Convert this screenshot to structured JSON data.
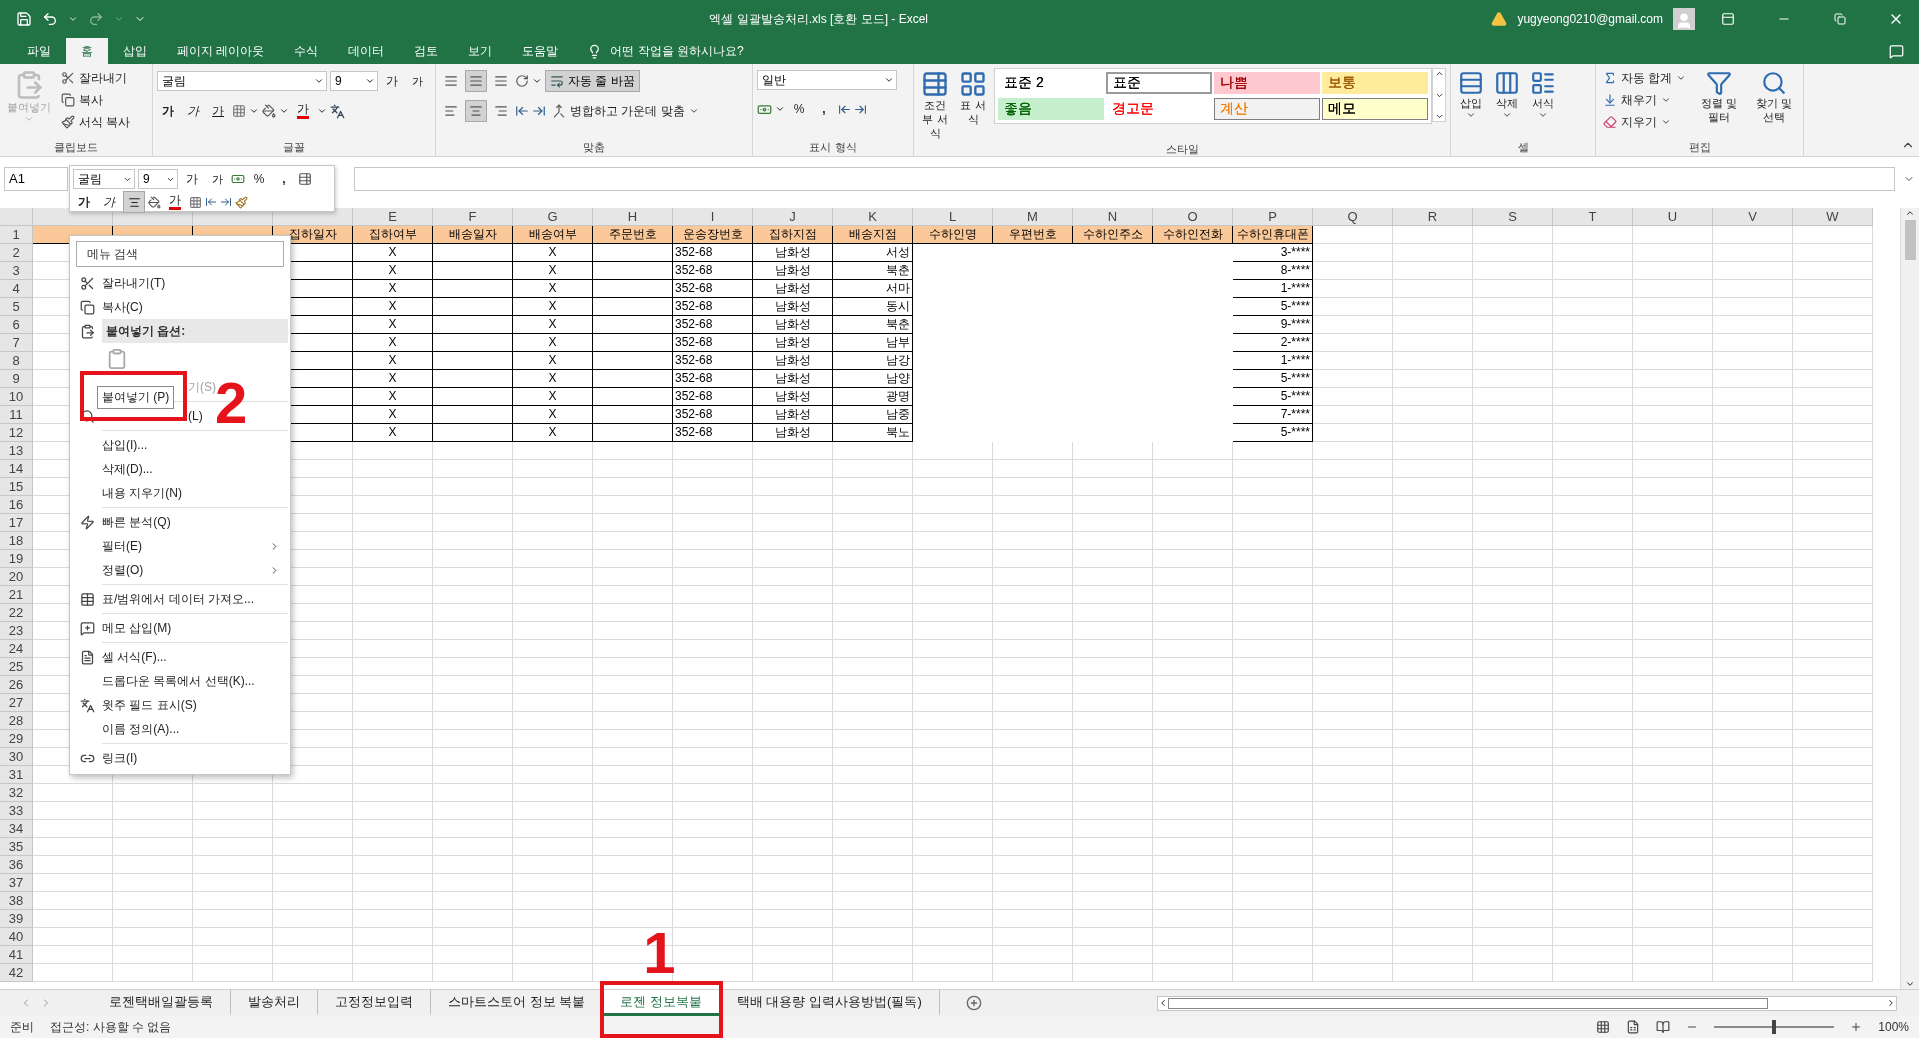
{
  "window": {
    "title": "엑셀 일괄발송처리.xls [호환 모드] - Excel",
    "account": "yugyeong0210@gmail.com"
  },
  "menu_tabs": [
    {
      "label": "파일",
      "selected": false
    },
    {
      "label": "홈",
      "selected": true
    },
    {
      "label": "삽입",
      "selected": false
    },
    {
      "label": "페이지 레이아웃",
      "selected": false
    },
    {
      "label": "수식",
      "selected": false
    },
    {
      "label": "데이터",
      "selected": false
    },
    {
      "label": "검토",
      "selected": false
    },
    {
      "label": "보기",
      "selected": false
    },
    {
      "label": "도움말",
      "selected": false
    }
  ],
  "tell_me": {
    "placeholder": "어떤 작업을 원하시나요?"
  },
  "ribbon": {
    "groups": [
      {
        "kind": "clipboard",
        "label": "클립보드",
        "paste": {
          "label": "붙여넣기",
          "disabled": true
        },
        "items": [
          "잘라내기",
          "복사",
          "서식 복사"
        ]
      },
      {
        "kind": "font",
        "label": "글꼴",
        "font": "굴림",
        "size": "9",
        "grow": "가",
        "shrink": "가",
        "bold": "가",
        "italic": "가",
        "underline": "가",
        "tint_letter": "가"
      },
      {
        "kind": "alignment",
        "label": "맞춤",
        "vertical": [
          {
            "selected": false
          },
          {
            "selected": true
          },
          {
            "selected": false
          }
        ],
        "horizontal": [
          {
            "selected": false
          },
          {
            "selected": true
          },
          {
            "selected": false
          }
        ],
        "wrap": {
          "label": "자동 줄 바꿈",
          "on": true
        },
        "merge": "병합하고 가운데 맞춤"
      },
      {
        "kind": "number",
        "label": "표시 형식",
        "format": "일반",
        "percent": "%",
        "comma": ","
      },
      {
        "kind": "styles",
        "label": "스타일",
        "buttons": [
          "조건부 서식",
          "표 서식"
        ],
        "styles": [
          {
            "label": "표준 2",
            "fill": {
              "color": "#ffffff"
            },
            "text": {
              "color": "#000000"
            },
            "selected": false,
            "outlined": false
          },
          {
            "label": "표준",
            "fill": {
              "color": "#ffffff"
            },
            "text": {
              "color": "#000000"
            },
            "selected": true,
            "outlined": false
          },
          {
            "label": "나쁨",
            "fill": {
              "color": "#ffc7ce"
            },
            "text": {
              "color": "#9c0006"
            },
            "selected": false,
            "outlined": false
          },
          {
            "label": "보통",
            "fill": {
              "color": "#ffeb9c"
            },
            "text": {
              "color": "#9c5700"
            },
            "selected": false,
            "outlined": false
          },
          {
            "label": "좋음",
            "fill": {
              "color": "#c6efce"
            },
            "text": {
              "color": "#006100"
            },
            "selected": false,
            "outlined": false
          },
          {
            "label": "경고문",
            "fill": {
              "color": "#ffffff"
            },
            "text": {
              "color": "#ff0000"
            },
            "selected": false,
            "outlined": false
          },
          {
            "label": "계산",
            "fill": {
              "color": "#f2f2f2"
            },
            "text": {
              "color": "#fa7d00"
            },
            "selected": false,
            "outlined": true
          },
          {
            "label": "메모",
            "fill": {
              "color": "#ffffcc"
            },
            "text": {
              "color": "#000000"
            },
            "selected": false,
            "outlined": true
          }
        ]
      },
      {
        "kind": "cells",
        "label": "셀",
        "buttons": [
          "삽입",
          "삭제",
          "서식"
        ]
      },
      {
        "kind": "editing",
        "label": "편집",
        "items": [
          "자동 합계",
          "채우기",
          "지우기"
        ],
        "buttons": [
          "정렬 및 필터",
          "찾기 및 선택"
        ]
      }
    ]
  },
  "formula_bar": {
    "name_box": "A1"
  },
  "mini_toolbar": {
    "font": "굴림",
    "size": "9",
    "grow": "가",
    "shrink": "가",
    "percent": "%",
    "comma": ",",
    "bold": "가",
    "italic": "가",
    "align_selected": true,
    "tint_letter": "가"
  },
  "sheet": {
    "columns": [
      "E",
      "F",
      "G",
      "H",
      "I",
      "J",
      "K",
      "L",
      "M",
      "N",
      "O",
      "P",
      "Q",
      "R",
      "S",
      "T",
      "U",
      "V",
      "W"
    ],
    "rows": [
      {
        "number": "1",
        "kind": "header",
        "d": "집하일자",
        "e": "집하여부",
        "f": "배송일자",
        "g": "배송여부",
        "h": "주문번호",
        "i": "운송장번호",
        "j": "집하지점",
        "k": "배송지점",
        "l": "수하인명",
        "m": "우편번호",
        "n": "수하인주소",
        "o": "수하인전화",
        "p": "수하인휴대폰"
      },
      {
        "number": "2",
        "kind": "data",
        "e": "X",
        "g": "X",
        "i": "352-68",
        "j": "남화성",
        "k": "서성",
        "p": "3-****"
      },
      {
        "number": "3",
        "kind": "data",
        "e": "X",
        "g": "X",
        "i": "352-68",
        "j": "남화성",
        "k": "북춘",
        "p": "8-****"
      },
      {
        "number": "4",
        "kind": "data",
        "e": "X",
        "g": "X",
        "i": "352-68",
        "j": "남화성",
        "k": "서마",
        "p": "1-****"
      },
      {
        "number": "5",
        "kind": "data",
        "e": "X",
        "g": "X",
        "i": "352-68",
        "j": "남화성",
        "k": "동시",
        "p": "5-****"
      },
      {
        "number": "6",
        "kind": "data",
        "e": "X",
        "g": "X",
        "i": "352-68",
        "j": "남화성",
        "k": "북춘",
        "p": "9-****"
      },
      {
        "number": "7",
        "kind": "data",
        "e": "X",
        "g": "X",
        "i": "352-68",
        "j": "남화성",
        "k": "남부",
        "p": "2-****"
      },
      {
        "number": "8",
        "kind": "data",
        "e": "X",
        "g": "X",
        "i": "352-68",
        "j": "남화성",
        "k": "남강",
        "p": "1-****"
      },
      {
        "number": "9",
        "kind": "data",
        "e": "X",
        "g": "X",
        "i": "352-68",
        "j": "남화성",
        "k": "남양",
        "p": "5-****"
      },
      {
        "number": "10",
        "kind": "data",
        "e": "X",
        "g": "X",
        "i": "352-68",
        "j": "남화성",
        "k": "광명",
        "p": "5-****"
      },
      {
        "number": "11",
        "kind": "data",
        "e": "X",
        "g": "X",
        "i": "352-68",
        "j": "남화성",
        "k": "남중",
        "p": "7-****"
      },
      {
        "number": "12",
        "kind": "data",
        "e": "X",
        "g": "X",
        "i": "352-68",
        "j": "남화성",
        "k": "북노",
        "p": "5-****"
      },
      {
        "number": "13",
        "kind": "blank"
      },
      {
        "number": "14",
        "kind": "blank"
      },
      {
        "number": "15",
        "kind": "blank"
      },
      {
        "number": "16",
        "kind": "blank"
      },
      {
        "number": "17",
        "kind": "blank"
      },
      {
        "number": "18",
        "kind": "blank"
      },
      {
        "number": "19",
        "kind": "blank"
      },
      {
        "number": "20",
        "kind": "blank"
      },
      {
        "number": "21",
        "kind": "blank"
      },
      {
        "number": "22",
        "kind": "blank"
      },
      {
        "number": "23",
        "kind": "blank"
      },
      {
        "number": "24",
        "kind": "blank"
      },
      {
        "number": "25",
        "kind": "blank"
      },
      {
        "number": "26",
        "kind": "blank"
      },
      {
        "number": "27",
        "kind": "blank"
      },
      {
        "number": "28",
        "kind": "blank"
      },
      {
        "number": "29",
        "kind": "blank"
      },
      {
        "number": "30",
        "kind": "blank"
      },
      {
        "number": "31",
        "kind": "blank"
      },
      {
        "number": "32",
        "kind": "blank"
      },
      {
        "number": "33",
        "kind": "blank"
      },
      {
        "number": "34",
        "kind": "blank"
      },
      {
        "number": "35",
        "kind": "blank"
      },
      {
        "number": "36",
        "kind": "blank"
      },
      {
        "number": "37",
        "kind": "blank"
      },
      {
        "number": "38",
        "kind": "blank"
      },
      {
        "number": "39",
        "kind": "blank"
      },
      {
        "number": "40",
        "kind": "blank"
      },
      {
        "number": "41",
        "kind": "blank"
      },
      {
        "number": "42",
        "kind": "blank"
      }
    ]
  },
  "context_menu": {
    "items": [
      {
        "kind": "search",
        "placeholder": "메뉴 검색"
      },
      {
        "kind": "item",
        "label": "잘라내기(T)",
        "disabled": false
      },
      {
        "kind": "item",
        "label": "복사(C)",
        "disabled": false
      },
      {
        "kind": "header",
        "label": "붙여넣기 옵션:"
      },
      {
        "kind": "paste-options"
      },
      {
        "kind": "item",
        "label": "기(S)",
        "disabled": true,
        "covered": true,
        "separator_after": true
      },
      {
        "kind": "item",
        "label": "(L)",
        "disabled": false,
        "covered": true,
        "separator_after": true
      },
      {
        "kind": "item",
        "label": "삽입(I)...",
        "disabled": false
      },
      {
        "kind": "item",
        "label": "삭제(D)...",
        "disabled": false
      },
      {
        "kind": "item",
        "label": "내용 지우기(N)",
        "disabled": false,
        "separator_after": true
      },
      {
        "kind": "item",
        "label": "빠른 분석(Q)",
        "disabled": false
      },
      {
        "kind": "item",
        "label": "필터(E)",
        "disabled": false,
        "submenu": true
      },
      {
        "kind": "item",
        "label": "정렬(O)",
        "disabled": false,
        "submenu": true,
        "separator_after": true
      },
      {
        "kind": "item",
        "label": "표/범위에서 데이터 가져오...",
        "disabled": false,
        "separator_after": true
      },
      {
        "kind": "item",
        "label": "메모 삽입(M)",
        "disabled": false,
        "separator_after": true
      },
      {
        "kind": "item",
        "label": "셀 서식(F)...",
        "disabled": false
      },
      {
        "kind": "item",
        "label": "드롭다운 목록에서 선택(K)...",
        "disabled": false
      },
      {
        "kind": "item",
        "label": "윗주 필드 표시(S)",
        "disabled": false
      },
      {
        "kind": "item",
        "label": "이름 정의(A)...",
        "disabled": false,
        "separator_after": true
      },
      {
        "kind": "item",
        "label": "링크(I)",
        "disabled": false
      }
    ]
  },
  "tooltip": {
    "text": "붙여넣기 (P)"
  },
  "annotations": [
    {
      "label": "2"
    },
    {
      "label": "1"
    }
  ],
  "sheet_tabs": [
    {
      "label": "로젠택배일괄등록",
      "selected": false
    },
    {
      "label": "발송처리",
      "selected": false
    },
    {
      "label": "고정정보입력",
      "selected": false
    },
    {
      "label": "스마트스토어 정보 복붙",
      "selected": false
    },
    {
      "label": "로젠 정보복붙",
      "selected": true
    },
    {
      "label": "택배 대용량 입력사용방법(필독)",
      "selected": false
    }
  ],
  "status_bar": {
    "ready": "준비",
    "accessibility": "접근성: 사용할 수 없음",
    "zoom": {
      "level": 0.5,
      "reading": "100%"
    }
  }
}
